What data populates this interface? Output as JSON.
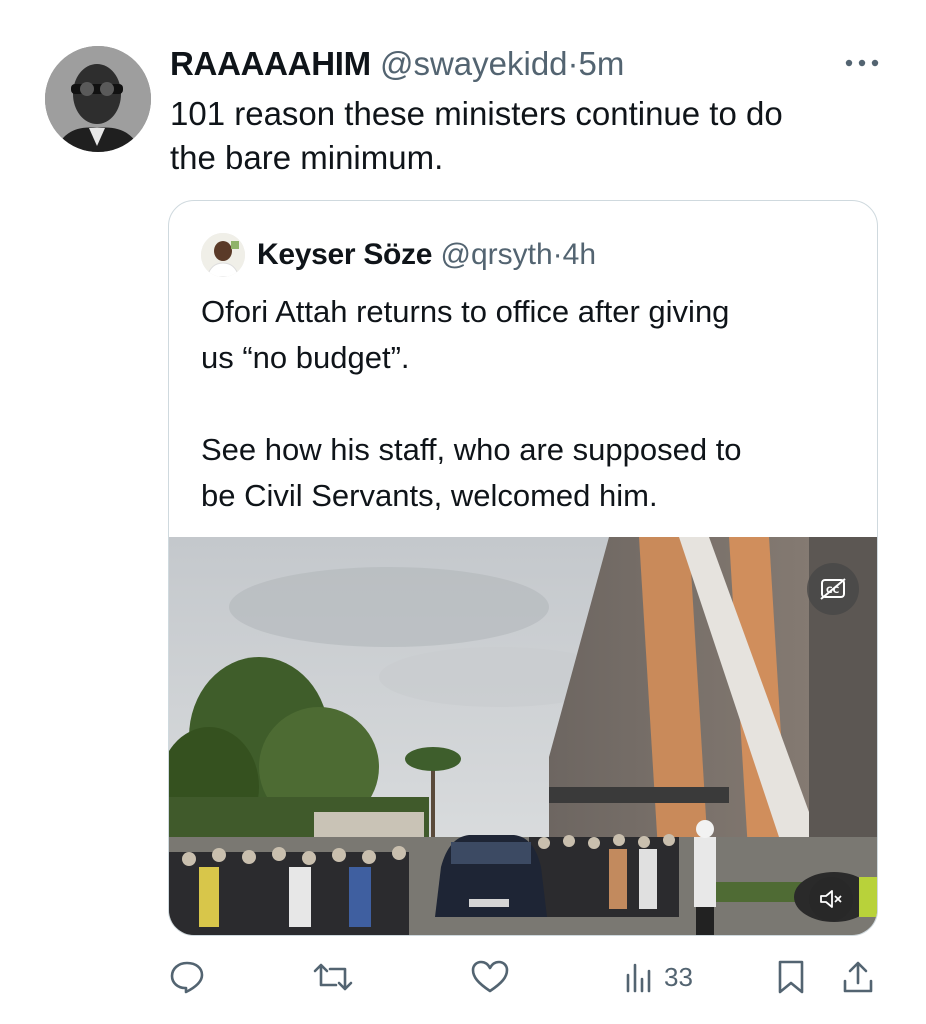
{
  "tweet": {
    "display_name": "RAAAAAHIM",
    "handle": "@swayekidd",
    "separator": "·",
    "time": "5m",
    "text": "101 reason these ministers continue to do\nthe bare minimum.",
    "more_icon": "more-horizontal-icon"
  },
  "quoted": {
    "display_name": "Keyser Söze",
    "handle": "@qrsyth",
    "separator": "·",
    "time": "4h",
    "text": "Ofori Attah returns to office after giving\nus “no budget”.\n\nSee how his staff, who are supposed to\nbe Civil Servants, welcomed him.",
    "media": {
      "type": "video",
      "captions_icon": "captions-off-icon",
      "mute_icon": "volume-muted-icon"
    }
  },
  "actions": {
    "reply_icon": "reply-icon",
    "retweet_icon": "retweet-icon",
    "like_icon": "like-icon",
    "views_icon": "views-icon",
    "views_count": "33",
    "bookmark_icon": "bookmark-icon",
    "share_icon": "share-icon"
  },
  "colors": {
    "text": "#0f1419",
    "muted": "#536471",
    "border": "#cfd9de"
  }
}
